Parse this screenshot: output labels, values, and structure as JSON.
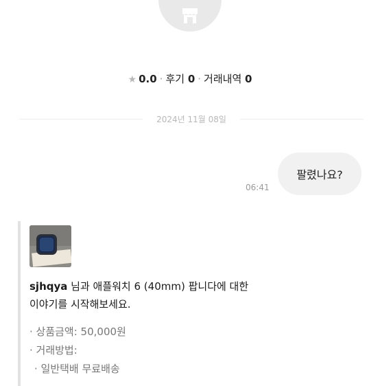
{
  "profile": {
    "rating": "0.0",
    "reviews_label": "후기",
    "reviews_count": "0",
    "transactions_label": "거래내역",
    "transactions_count": "0",
    "separator": "·"
  },
  "date_divider": "2024년 11월 08일",
  "message": {
    "text": "팔렸나요?",
    "time": "06:41"
  },
  "product_card": {
    "username": "sjhqya",
    "intro": " 님과 애플워치 6 (40mm) 팝니다에 대한",
    "intro_line2": "이야기를 시작해보세요.",
    "price_line": "· 상품금액: 50,000원",
    "method_line": "· 거래방법:",
    "method_value": "· 일반택배 무료배송"
  }
}
